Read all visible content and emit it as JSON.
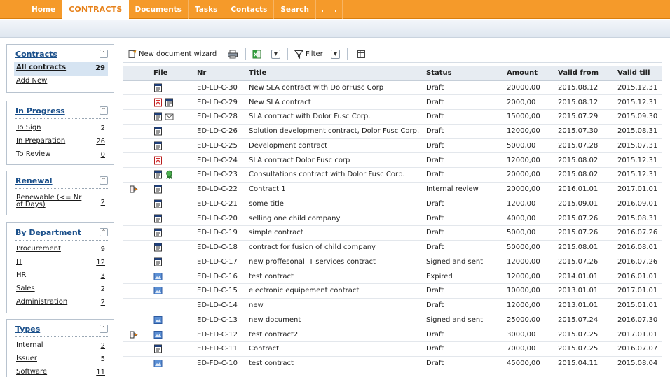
{
  "nav": {
    "items": [
      "Home",
      "CONTRACTS",
      "Documents",
      "Tasks",
      "Contacts",
      "Search",
      ".",
      "."
    ],
    "active_index": 1
  },
  "sidebar": {
    "contracts": {
      "title": "Contracts",
      "items": [
        {
          "label": "All contracts",
          "count": "29"
        },
        {
          "label": "Add New",
          "count": ""
        }
      ]
    },
    "in_progress": {
      "title": "In Progress",
      "items": [
        {
          "label": "To Sign",
          "count": "2"
        },
        {
          "label": "In Preparation",
          "count": "26"
        },
        {
          "label": "To Review",
          "count": "0"
        }
      ]
    },
    "renewal": {
      "title": "Renewal",
      "items": [
        {
          "label": "Renewable (<= Nr of Days)",
          "count": "2"
        }
      ]
    },
    "by_department": {
      "title": "By Department",
      "items": [
        {
          "label": "Procurement",
          "count": "9"
        },
        {
          "label": "IT",
          "count": "12"
        },
        {
          "label": "HR",
          "count": "3"
        },
        {
          "label": "Sales",
          "count": "2"
        },
        {
          "label": "Administration",
          "count": "2"
        }
      ]
    },
    "types": {
      "title": "Types",
      "items": [
        {
          "label": "Internal",
          "count": "2"
        },
        {
          "label": "Issuer",
          "count": "5"
        },
        {
          "label": "Software",
          "count": "11"
        }
      ]
    }
  },
  "toolbar": {
    "wizard_label": "New document wizard",
    "filter_label": "Filter"
  },
  "table": {
    "headers": {
      "file": "File",
      "nr": "Nr",
      "title": "Title",
      "status": "Status",
      "amount": "Amount",
      "valid_from": "Valid from",
      "valid_till": "Valid till"
    },
    "rows": [
      {
        "flag": "",
        "files": [
          "word-doc-icon"
        ],
        "nr": "ED-LD-C-30",
        "title": "New SLA contract with DolorFusc Corp",
        "status": "Draft",
        "amount": "20000,00",
        "from": "2015.08.12",
        "till": "2015.12.31"
      },
      {
        "flag": "",
        "files": [
          "pdf-icon",
          "word-doc-icon"
        ],
        "nr": "ED-LD-C-29",
        "title": "New SLA contract",
        "status": "Draft",
        "amount": "2000,00",
        "from": "2015.08.12",
        "till": "2015.12.31"
      },
      {
        "flag": "",
        "files": [
          "word-doc-icon",
          "email-icon"
        ],
        "nr": "ED-LD-C-28",
        "title": "SLA contract with Dolor Fusc Corp.",
        "status": "Draft",
        "amount": "15000,00",
        "from": "2015.07.29",
        "till": "2015.09.30"
      },
      {
        "flag": "",
        "files": [
          "word-doc-icon"
        ],
        "nr": "ED-LD-C-26",
        "title": "Solution development contract, Dolor Fusc Corp.",
        "status": "Draft",
        "amount": "12000,00",
        "from": "2015.07.30",
        "till": "2015.08.31"
      },
      {
        "flag": "",
        "files": [
          "word-doc-icon"
        ],
        "nr": "ED-LD-C-25",
        "title": "Development contract",
        "status": "Draft",
        "amount": "5000,00",
        "from": "2015.07.28",
        "till": "2015.07.31"
      },
      {
        "flag": "",
        "files": [
          "pdf-icon"
        ],
        "nr": "ED-LD-C-24",
        "title": "SLA contract Dolor Fusc corp",
        "status": "Draft",
        "amount": "12000,00",
        "from": "2015.08.02",
        "till": "2015.12.31"
      },
      {
        "flag": "",
        "files": [
          "word-doc-icon",
          "certificate-icon"
        ],
        "nr": "ED-LD-C-23",
        "title": "Consultations contract with Dolor Fusc Corp.",
        "status": "Draft",
        "amount": "20000,00",
        "from": "2015.08.02",
        "till": "2015.12.31"
      },
      {
        "flag": "review-flag-icon",
        "files": [
          "word-doc-icon"
        ],
        "nr": "ED-LD-C-22",
        "title": "Contract 1",
        "status": "Internal review",
        "amount": "20000,00",
        "from": "2016.01.01",
        "till": "2017.01.01"
      },
      {
        "flag": "",
        "files": [
          "word-doc-icon"
        ],
        "nr": "ED-LD-C-21",
        "title": "some title",
        "status": "Draft",
        "amount": "1200,00",
        "from": "2015.09.01",
        "till": "2016.09.01"
      },
      {
        "flag": "",
        "files": [
          "word-doc-icon"
        ],
        "nr": "ED-LD-C-20",
        "title": "selling one child company",
        "status": "Draft",
        "amount": "4000,00",
        "from": "2015.07.26",
        "till": "2015.08.31"
      },
      {
        "flag": "",
        "files": [
          "word-doc-icon"
        ],
        "nr": "ED-LD-C-19",
        "title": "simple contract",
        "status": "Draft",
        "amount": "5000,00",
        "from": "2015.07.26",
        "till": "2016.07.26"
      },
      {
        "flag": "",
        "files": [
          "word-doc-icon"
        ],
        "nr": "ED-LD-C-18",
        "title": "contract for fusion of child company",
        "status": "Draft",
        "amount": "50000,00",
        "from": "2015.08.01",
        "till": "2016.08.01"
      },
      {
        "flag": "",
        "files": [
          "word-doc-icon"
        ],
        "nr": "ED-LD-C-17",
        "title": "new proffesonal IT services contract",
        "status": "Signed and sent",
        "amount": "12000,00",
        "from": "2015.07.26",
        "till": "2016.07.26"
      },
      {
        "flag": "",
        "files": [
          "picture-icon"
        ],
        "nr": "ED-LD-C-16",
        "title": "test contract",
        "status": "Expired",
        "amount": "12000,00",
        "from": "2014.01.01",
        "till": "2016.01.01"
      },
      {
        "flag": "",
        "files": [
          "picture-icon"
        ],
        "nr": "ED-LD-C-15",
        "title": "electronic equipement contract",
        "status": "Draft",
        "amount": "10000,00",
        "from": "2013.01.01",
        "till": "2017.01.01"
      },
      {
        "flag": "",
        "files": [],
        "nr": "ED-LD-C-14",
        "title": "new",
        "status": "Draft",
        "amount": "12000,00",
        "from": "2013.01.01",
        "till": "2015.01.01"
      },
      {
        "flag": "",
        "files": [
          "picture-icon"
        ],
        "nr": "ED-LD-C-13",
        "title": "new document",
        "status": "Signed and sent",
        "amount": "25000,00",
        "from": "2015.07.24",
        "till": "2016.07.30"
      },
      {
        "flag": "review-flag-icon",
        "files": [
          "picture-icon"
        ],
        "nr": "ED-FD-C-12",
        "title": "test contract2",
        "status": "Draft",
        "amount": "3000,00",
        "from": "2015.07.25",
        "till": "2017.01.01"
      },
      {
        "flag": "",
        "files": [
          "word-doc-icon"
        ],
        "nr": "ED-FD-C-11",
        "title": "Contract",
        "status": "Draft",
        "amount": "7000,00",
        "from": "2015.07.25",
        "till": "2016.07.07"
      },
      {
        "flag": "",
        "files": [
          "picture-icon"
        ],
        "nr": "ED-FD-C-10",
        "title": "test contract",
        "status": "Draft",
        "amount": "45000,00",
        "from": "2015.04.11",
        "till": "2015.08.04"
      }
    ]
  }
}
